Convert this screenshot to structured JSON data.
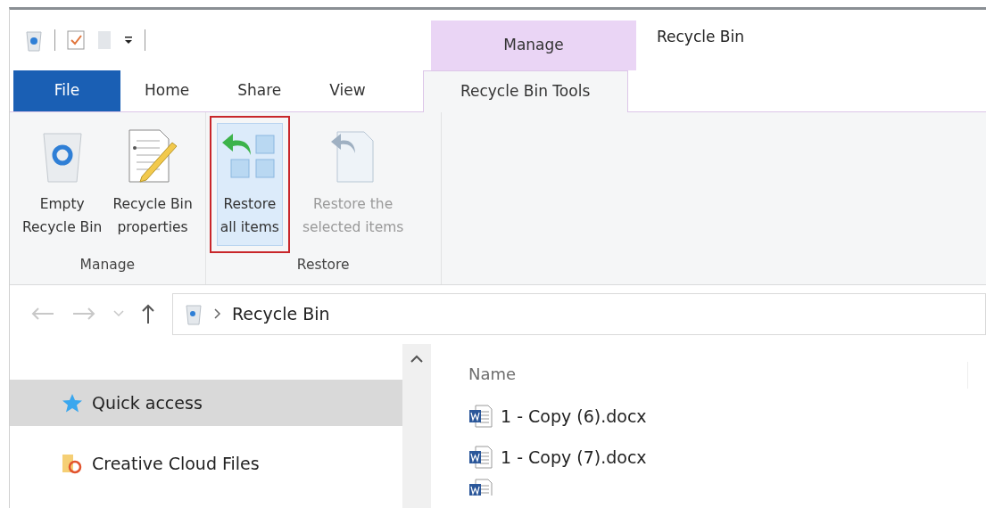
{
  "window": {
    "title": "Recycle Bin"
  },
  "context_tab_group": {
    "label": "Manage"
  },
  "ribbon_tabs": [
    {
      "label": "File",
      "kind": "file",
      "selected": false
    },
    {
      "label": "Home",
      "kind": "normal",
      "selected": false
    },
    {
      "label": "Share",
      "kind": "normal",
      "selected": false
    },
    {
      "label": "View",
      "kind": "normal",
      "selected": false
    },
    {
      "label": "Recycle Bin Tools",
      "kind": "context",
      "selected": true
    }
  ],
  "ribbon_groups": [
    {
      "label": "Manage",
      "buttons": [
        {
          "label": "Empty\nRecycle Bin",
          "kind": "bin",
          "disabled": false,
          "highlighted": false,
          "outlined": false
        },
        {
          "label": "Recycle Bin\nproperties",
          "kind": "properties",
          "disabled": false,
          "highlighted": false,
          "outlined": false
        }
      ]
    },
    {
      "label": "Restore",
      "buttons": [
        {
          "label": "Restore\nall items",
          "kind": "restore_all",
          "disabled": false,
          "highlighted": true,
          "outlined": true
        },
        {
          "label": "Restore the\nselected items",
          "kind": "restore_selected",
          "disabled": true,
          "highlighted": false,
          "outlined": false
        }
      ]
    }
  ],
  "address_bar": {
    "path": "Recycle Bin"
  },
  "nav_pane": {
    "items": [
      {
        "label": "Quick access",
        "kind": "star",
        "selected": true
      },
      {
        "label": "Creative Cloud Files",
        "kind": "cloud_folder",
        "selected": false
      }
    ]
  },
  "file_list": {
    "columns": [
      "Name"
    ],
    "rows": [
      {
        "name": "1 - Copy (6).docx"
      },
      {
        "name": "1 - Copy (7).docx"
      }
    ]
  }
}
